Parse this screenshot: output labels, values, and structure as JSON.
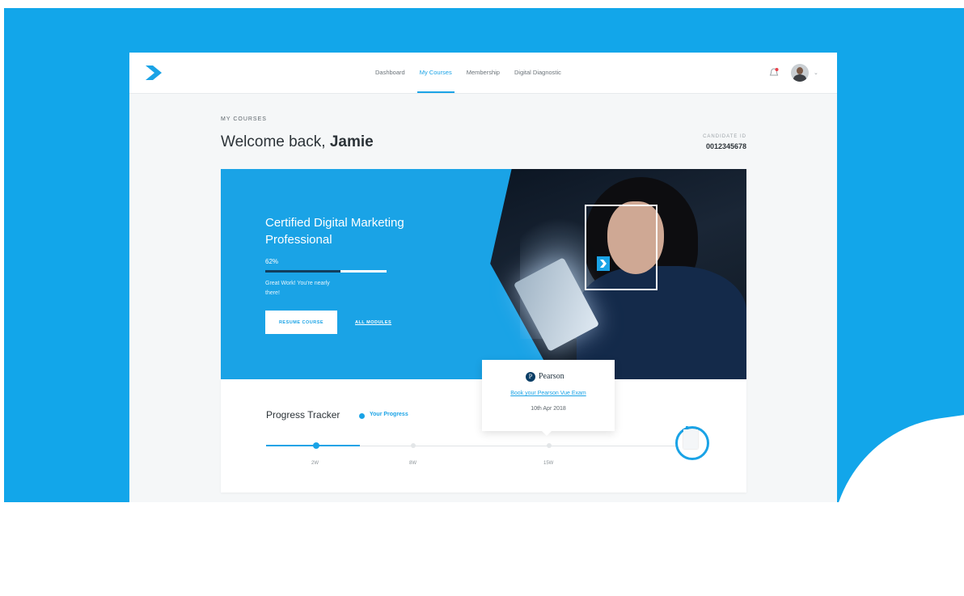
{
  "nav": {
    "items": [
      {
        "label": "Dashboard",
        "active": false
      },
      {
        "label": "My Courses",
        "active": true
      },
      {
        "label": "Membership",
        "active": false
      },
      {
        "label": "Digital Diagnostic",
        "active": false
      }
    ]
  },
  "header": {
    "eyebrow": "MY COURSES",
    "welcome_prefix": "Welcome back,",
    "user_name": "Jamie",
    "candidate_label": "CANDIDATE ID",
    "candidate_id": "0012345678"
  },
  "course": {
    "title": "Certified Digital Marketing Professional",
    "progress_label": "62%",
    "progress_fraction": 0.62,
    "encouragement": "Great Work! You're nearly there!",
    "resume_label": "RESUME COURSE",
    "all_modules_label": "ALL MODULES"
  },
  "pearson": {
    "brand": "Pearson",
    "link_label": "Book your Pearson Vue Exam",
    "date": "10th Apr 2018"
  },
  "tracker": {
    "title": "Progress Tracker",
    "legend": "Your Progress",
    "milestones": [
      "2W",
      "8W",
      "15W"
    ]
  },
  "colors": {
    "brand_blue": "#1aa3e6",
    "background_blue": "#12a6ea",
    "dark_navy": "#123e5d"
  },
  "icons": [
    "logo-chevron-icon",
    "notification-bell-icon",
    "avatar",
    "chevron-down-icon",
    "pearson-logo-icon",
    "certificate-icon"
  ]
}
